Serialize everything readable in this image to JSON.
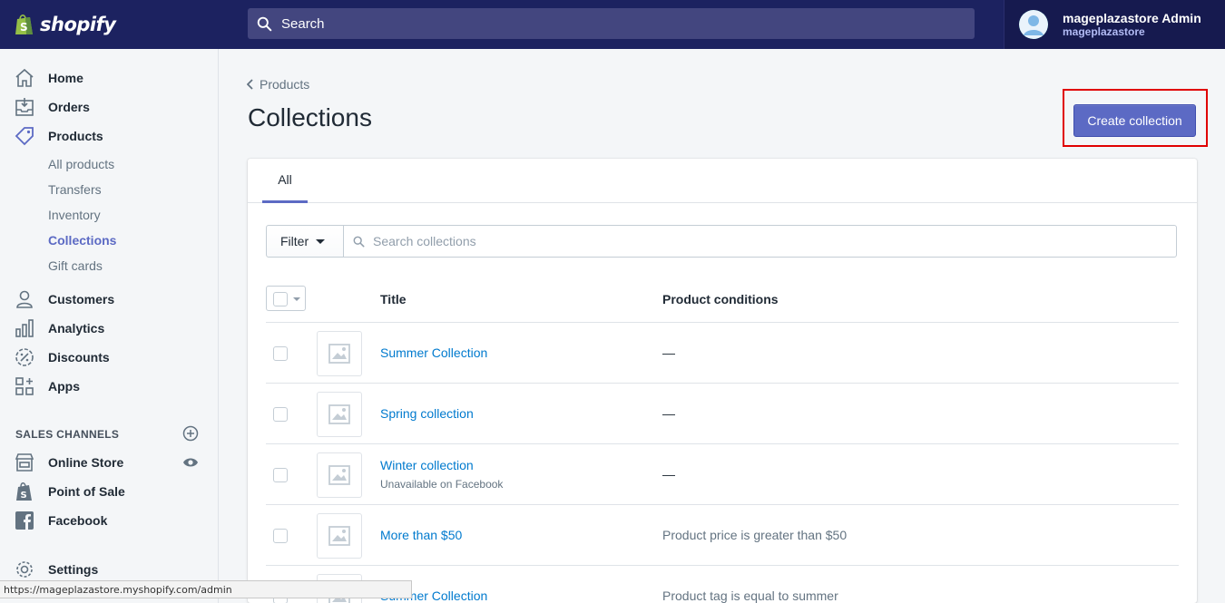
{
  "topbar": {
    "logo_text": "shopify",
    "search_placeholder": "Search",
    "user_name": "mageplazastore Admin",
    "user_store": "mageplazastore"
  },
  "sidebar": {
    "items": [
      {
        "label": "Home",
        "icon": "home-icon"
      },
      {
        "label": "Orders",
        "icon": "orders-icon"
      },
      {
        "label": "Products",
        "icon": "tag-icon"
      }
    ],
    "product_sub": [
      "All products",
      "Transfers",
      "Inventory",
      "Collections",
      "Gift cards"
    ],
    "active_sub": "Collections",
    "items2": [
      {
        "label": "Customers",
        "icon": "customers-icon"
      },
      {
        "label": "Analytics",
        "icon": "analytics-icon"
      },
      {
        "label": "Discounts",
        "icon": "discounts-icon"
      },
      {
        "label": "Apps",
        "icon": "apps-icon"
      }
    ],
    "sales_channels_title": "SALES CHANNELS",
    "channels": [
      {
        "label": "Online Store",
        "icon": "store-icon"
      },
      {
        "label": "Point of Sale",
        "icon": "pos-bag-icon"
      },
      {
        "label": "Facebook",
        "icon": "facebook-icon"
      }
    ],
    "settings_label": "Settings"
  },
  "page": {
    "breadcrumb": "Products",
    "title": "Collections",
    "create_button": "Create collection",
    "tab_all": "All",
    "filter_label": "Filter",
    "search_placeholder": "Search collections",
    "col_title": "Title",
    "col_conditions": "Product conditions"
  },
  "rows": [
    {
      "title": "Summer Collection",
      "subtitle": "",
      "conditions": "—"
    },
    {
      "title": "Spring collection",
      "subtitle": "",
      "conditions": "—"
    },
    {
      "title": "Winter collection",
      "subtitle": "Unavailable on Facebook",
      "conditions": "—"
    },
    {
      "title": "More than $50",
      "subtitle": "",
      "conditions": "Product price is greater than $50"
    },
    {
      "title": "Summer Collection",
      "subtitle": "",
      "conditions": "Product tag is equal to summer"
    }
  ],
  "status_bar_url": "https://mageplazastore.myshopify.com/admin",
  "colors": {
    "topbar": "#1c2260",
    "accent": "#5c6ac4",
    "link": "#007ace",
    "highlight": "#e00000"
  }
}
